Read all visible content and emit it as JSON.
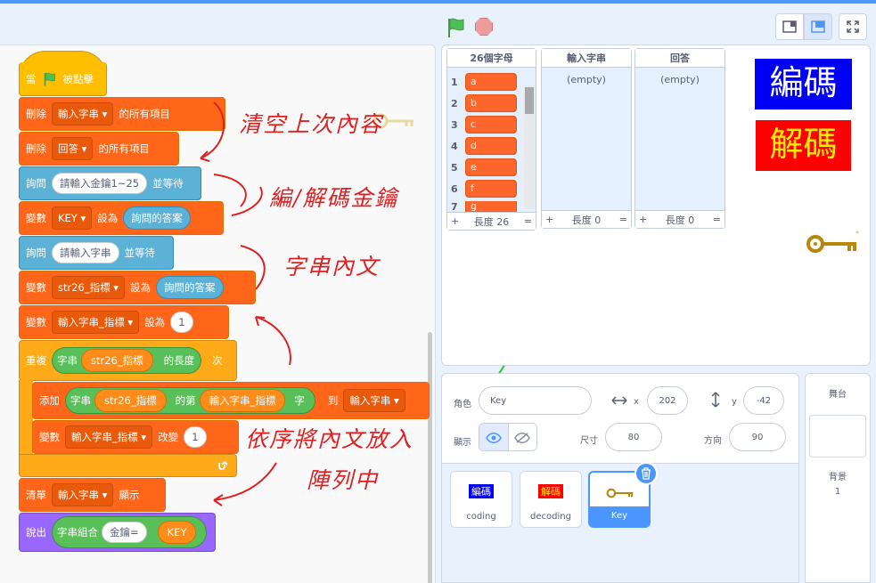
{
  "header": {
    "small_stage": "small-stage",
    "large_stage": "large-stage",
    "fullscreen": "fullscreen"
  },
  "code": {
    "hat": {
      "when": "當",
      "clicked": "被點擊"
    },
    "b1": {
      "pre": "刪除",
      "list": "輸入字串 ▾",
      "post": "的所有項目"
    },
    "b2": {
      "pre": "刪除",
      "list": "回答 ▾",
      "post": "的所有項目"
    },
    "b3": {
      "pre": "詢問",
      "prompt": "請輸入金鑰1~25",
      "post": "並等待"
    },
    "b4": {
      "pre": "變數",
      "var": "KEY ▾",
      "mid": "設為",
      "val": "詢問的答案"
    },
    "b5": {
      "pre": "詢問",
      "prompt": "請輸入字串",
      "post": "並等待"
    },
    "b6": {
      "pre": "變數",
      "var": "str26_指標 ▾",
      "mid": "設為",
      "val": "詢問的答案"
    },
    "b7": {
      "pre": "變數",
      "var": "輸入字串_指標 ▾",
      "mid": "設為",
      "val": "1"
    },
    "b8": {
      "pre": "重複",
      "op": "字串",
      "var": "str26_指標",
      "post": "的長度",
      "tail": "次"
    },
    "b9": {
      "pre": "添加",
      "op": "字串",
      "var": "str26_指標",
      "mid": "的第",
      "var2": "輸入字串_指標",
      "post": "字",
      "to": "到",
      "list": "輸入字串 ▾"
    },
    "b10": {
      "pre": "變數",
      "var": "輸入字串_指標 ▾",
      "mid": "改變",
      "val": "1"
    },
    "b11": {
      "pre": "清單",
      "list": "輸入字串 ▾",
      "post": "顯示"
    },
    "b12": {
      "pre": "說出",
      "op": "字串組合",
      "a": "金鑰=",
      "b": "KEY"
    }
  },
  "annotations": [
    "清空上次內容",
    "編/解碼金鑰",
    "字串內文",
    "依序將內文放入",
    "陣列中"
  ],
  "monitors": {
    "alpha": {
      "title": "26個字母",
      "items": [
        "a",
        "b",
        "c",
        "d",
        "e",
        "f",
        "g"
      ],
      "length": "長度 26"
    },
    "input": {
      "title": "輸入字串",
      "empty": "(empty)",
      "length": "長度 0"
    },
    "answer": {
      "title": "回答",
      "empty": "(empty)",
      "length": "長度 0"
    }
  },
  "stage": {
    "encode": "編碼",
    "decode": "解碼"
  },
  "sprite_info": {
    "sprite_label": "角色",
    "sprite_name": "Key",
    "x_label": "x",
    "x": "202",
    "y_label": "y",
    "y": "-42",
    "show_label": "顯示",
    "size_label": "尺寸",
    "size": "80",
    "dir_label": "方向",
    "dir": "90"
  },
  "sprites": [
    {
      "thumb": "編碼",
      "name": "coding"
    },
    {
      "thumb": "解碼",
      "name": "decoding"
    },
    {
      "name": "Key"
    }
  ],
  "stage_panel": {
    "title": "舞台",
    "backdrop_label": "背景",
    "backdrop_count": "1"
  },
  "colors": {
    "events": "#ffbf00",
    "data": "#ff661a",
    "sensing": "#5cb1d6",
    "control": "#ffab19",
    "operators": "#59c059",
    "looks": "#9966ff",
    "list": "#fc662c",
    "annotation": "#e02020",
    "arrow": "#22cc22"
  }
}
